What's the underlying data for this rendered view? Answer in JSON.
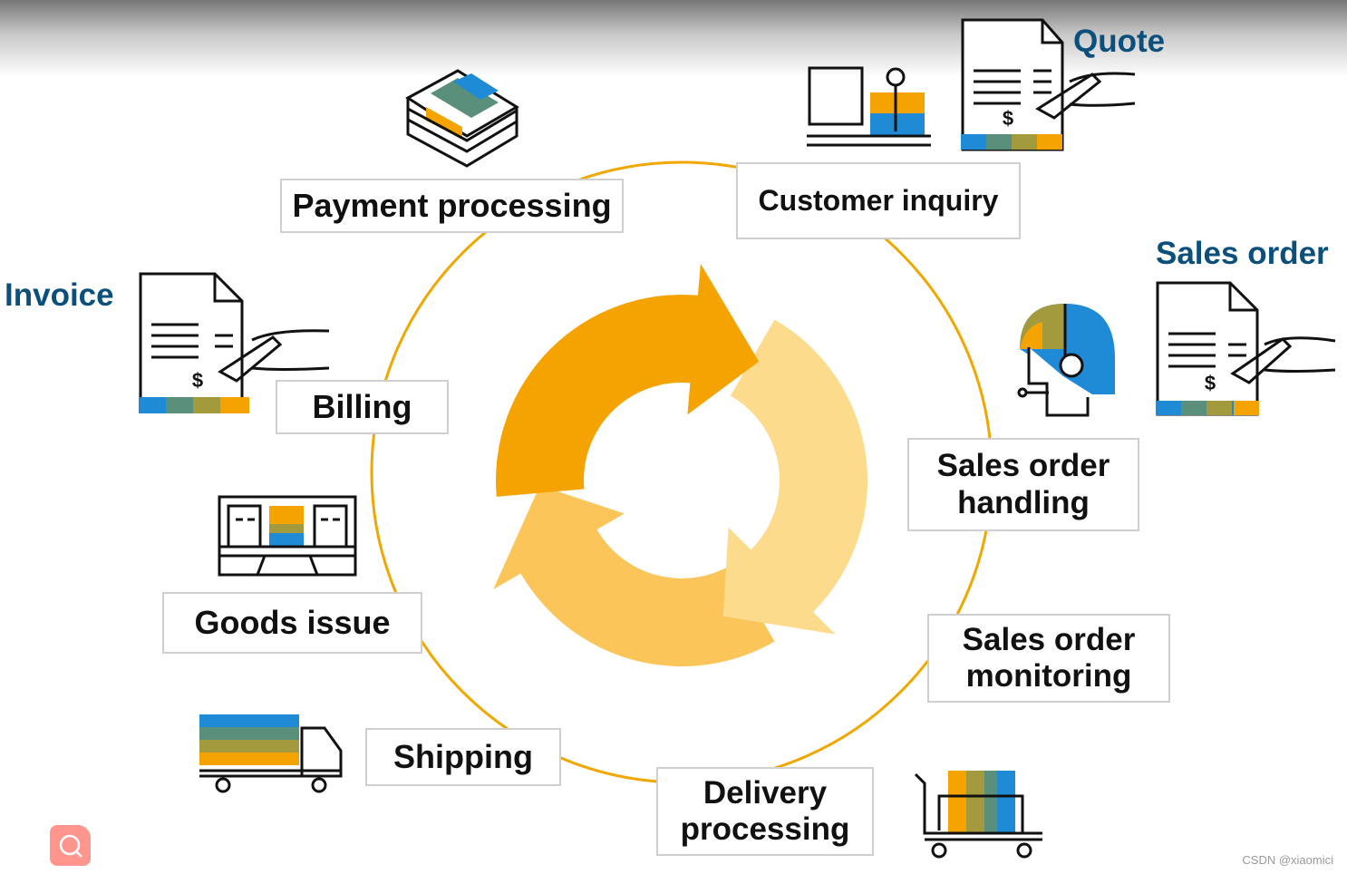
{
  "steps": {
    "payment": "Payment processing",
    "inquiry": "Customer inquiry",
    "billing": "Billing",
    "so_handling_1": "Sales order",
    "so_handling_2": "handling",
    "goods_issue": "Goods issue",
    "so_monitoring_1": "Sales order",
    "so_monitoring_2": "monitoring",
    "shipping": "Shipping",
    "delivery_1": "Delivery",
    "delivery_2": "processing"
  },
  "documents": {
    "quote": "Quote",
    "sales_order": "Sales order",
    "invoice": "Invoice"
  },
  "currency_symbol": "$",
  "watermark": "CSDN @xiaomici",
  "colors": {
    "ring": "#f0a800",
    "arrow_dark": "#f5a300",
    "arrow_light": "#fddb8c",
    "arrow_mid": "#fbc55a",
    "doc_label": "#0b4f7c",
    "search_button": "#ff958d"
  },
  "icons": [
    "cash-stack-icon",
    "customer-desk-icon",
    "document-sign-icon",
    "agent-headset-icon",
    "warehouse-icon",
    "truck-icon",
    "cart-icon",
    "search-icon"
  ]
}
